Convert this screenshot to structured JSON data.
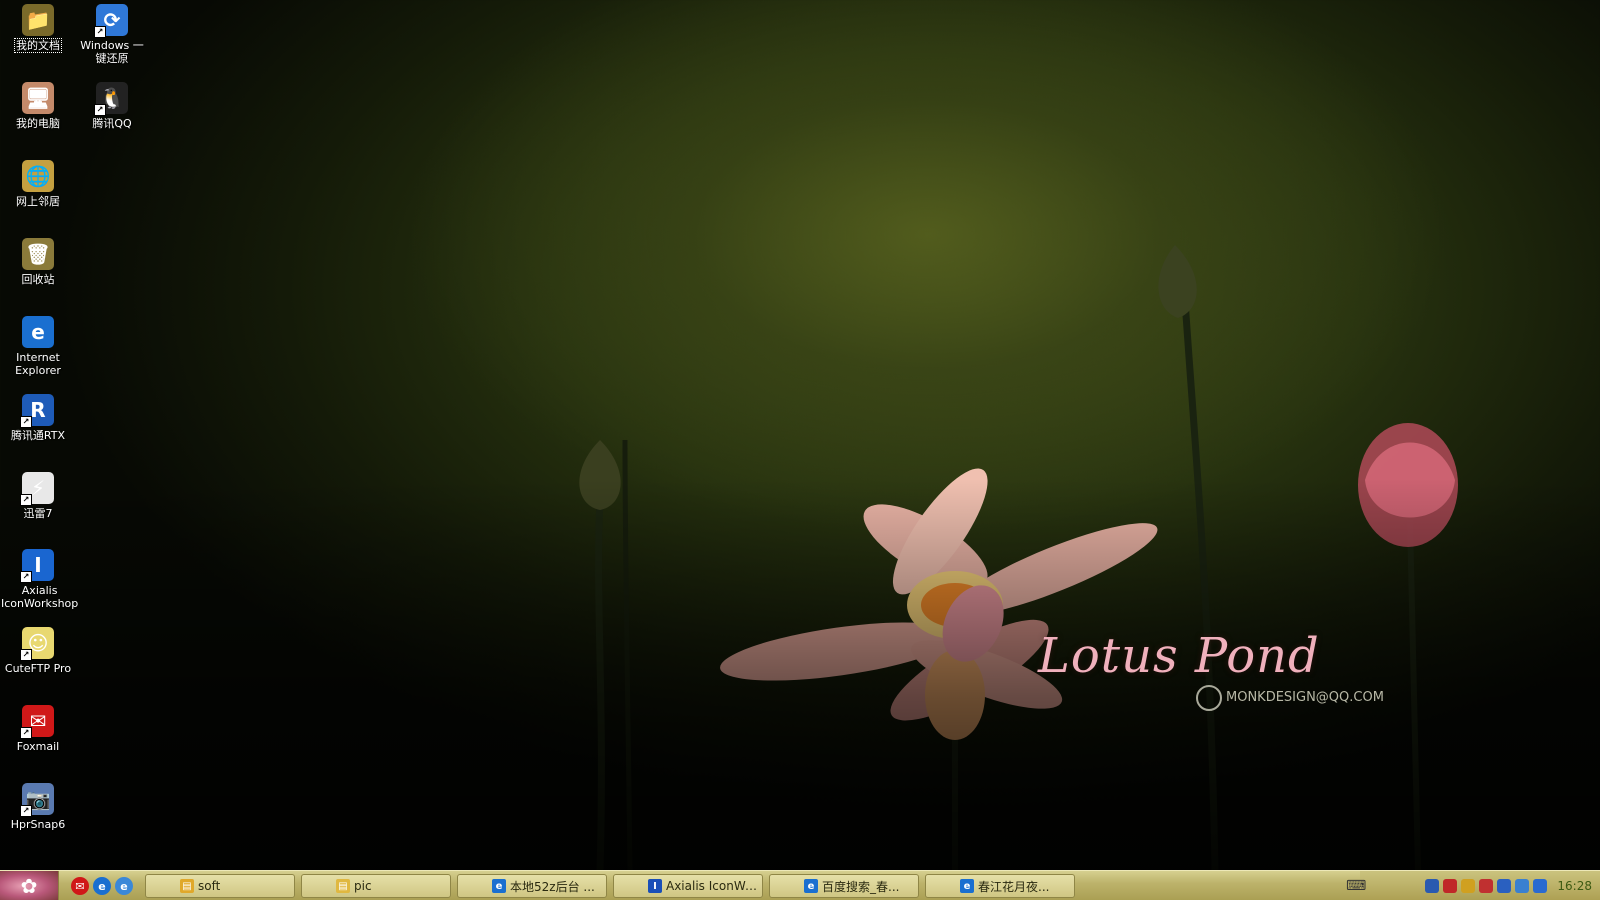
{
  "desktop": {
    "icons": [
      {
        "label": "我的文档",
        "name": "my-documents-icon",
        "color": "#7a6a2a",
        "glyph": "📁",
        "shortcut": false,
        "selected": true
      },
      {
        "label": "Windows 一键还原",
        "name": "windows-restore-icon",
        "color": "#2f78d8",
        "glyph": "⟳",
        "shortcut": true,
        "selected": false
      },
      {
        "label": "我的电脑",
        "name": "my-computer-icon",
        "color": "#c48a6a",
        "glyph": "🖥",
        "shortcut": false,
        "selected": false
      },
      {
        "label": "腾讯QQ",
        "name": "tencent-qq-icon",
        "color": "#222222",
        "glyph": "🐧",
        "shortcut": true,
        "selected": false
      },
      {
        "label": "网上邻居",
        "name": "network-places-icon",
        "color": "#c4a040",
        "glyph": "🌐",
        "shortcut": false,
        "selected": false
      },
      {
        "label": "回收站",
        "name": "recycle-bin-icon",
        "color": "#8a7a3a",
        "glyph": "🗑",
        "shortcut": false,
        "selected": false
      },
      {
        "label": "Internet Explorer",
        "name": "internet-explorer-icon",
        "color": "#1a6fd0",
        "glyph": "e",
        "shortcut": false,
        "selected": false
      },
      {
        "label": "腾讯通RTX",
        "name": "tencent-rtx-icon",
        "color": "#1e5bb8",
        "glyph": "R",
        "shortcut": true,
        "selected": false
      },
      {
        "label": "迅雷7",
        "name": "thunder-icon",
        "color": "#e8e8e8",
        "glyph": "⚡",
        "shortcut": true,
        "selected": false
      },
      {
        "label": "Axialis IconWorkshop",
        "name": "axialis-iconworkshop-icon",
        "color": "#1a66d0",
        "glyph": "I",
        "shortcut": true,
        "selected": false
      },
      {
        "label": "CuteFTP Pro",
        "name": "cuteftp-icon",
        "color": "#e8d870",
        "glyph": "☺",
        "shortcut": true,
        "selected": false
      },
      {
        "label": "Foxmail",
        "name": "foxmail-icon",
        "color": "#d01818",
        "glyph": "✉",
        "shortcut": true,
        "selected": false
      },
      {
        "label": "HprSnap6",
        "name": "hprsnap-icon",
        "color": "#5a7ab0",
        "glyph": "📷",
        "shortcut": true,
        "selected": false
      }
    ]
  },
  "wallpaper": {
    "title": "Lotus Pond",
    "credit": "MONKDESIGN@QQ.COM"
  },
  "taskbar": {
    "quick_launch": [
      {
        "name": "foxmail-quick-icon",
        "color": "#d01818",
        "glyph": "✉"
      },
      {
        "name": "ie-quick-icon",
        "color": "#1a6fd0",
        "glyph": "e"
      },
      {
        "name": "ie-alt-quick-icon",
        "color": "#3a88d8",
        "glyph": "e"
      }
    ],
    "tasks": [
      {
        "label": "soft",
        "name": "folder-icon",
        "color": "#e0a82a",
        "glyph": "▤"
      },
      {
        "label": "pic",
        "name": "folder-icon",
        "color": "#e0b840",
        "glyph": "▤"
      },
      {
        "label": "本地52z后台 ...",
        "name": "ie-icon",
        "color": "#1a6fd0",
        "glyph": "e"
      },
      {
        "label": "Axialis IconWo...",
        "name": "axialis-icon",
        "color": "#1a4fb8",
        "glyph": "I"
      },
      {
        "label": "百度搜索_春...",
        "name": "ie-icon",
        "color": "#1a6fd0",
        "glyph": "e"
      },
      {
        "label": "春江花月夜...",
        "name": "ie-icon",
        "color": "#1a6fd0",
        "glyph": "e"
      }
    ],
    "tray_icons": [
      {
        "name": "network-tray-icon",
        "color": "#2a5ab0"
      },
      {
        "name": "shield-tray-icon",
        "color": "#c02828"
      },
      {
        "name": "antivirus-tray-icon",
        "color": "#d0a020"
      },
      {
        "name": "qq-tray-icon",
        "color": "#c03030"
      },
      {
        "name": "rtx-tray-icon",
        "color": "#2a60c0"
      },
      {
        "name": "thunder-tray-icon",
        "color": "#3a80d0"
      },
      {
        "name": "volume-tray-icon",
        "color": "#2a6ad0"
      }
    ],
    "clock": "16:28"
  }
}
